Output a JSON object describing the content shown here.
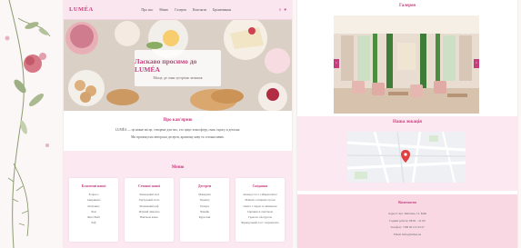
{
  "nav": {
    "brand": "LUMÉA",
    "links": [
      "Про нас",
      "Меню",
      "Галерея",
      "Контакти",
      "Бронювання"
    ],
    "icons": [
      "search-icon",
      "cart-icon"
    ]
  },
  "hero": {
    "title": "Ласкаво просимо до LUMÉA",
    "subtitle": "Місце, де смак зустрічає затишок"
  },
  "about": {
    "title": "Про кав'ярню",
    "text_1": "LUMÉA — це ніжне місце, створене для тих, хто цінує атмосферу, смак і красу в деталях.",
    "text_2": "Ми пропонуємо авторські десерти, ароматну каву та сезонні меню."
  },
  "menu": {
    "title": "Меню",
    "cards": [
      {
        "title": "Класичні напої",
        "items": [
          "Еспресо",
          "Американо",
          "Капучино",
          "Лате",
          "Флет Вайт",
          "Раф"
        ]
      },
      {
        "title": "Сезонні напої",
        "items": [
          "Лавандовий лате",
          "Гарбузовий латте",
          "Малиновий раф",
          "Ягідний лимонад",
          "Ванільна какао"
        ]
      },
      {
        "title": "Десерти",
        "items": [
          "Макаруни",
          "Тірамісу",
          "Еклери",
          "Чізкейк",
          "Круасани"
        ]
      },
      {
        "title": "Сніданки",
        "items": [
          "Авокадо тост з яйцем пашот",
          "Млинці з ягідним соусом",
          "Омлет з сиром та шпинатом",
          "Сирники зі сметаною",
          "Гранола з йогуртом",
          "Французький тост з карамеллю"
        ]
      }
    ]
  },
  "gallery": {
    "title": "Галерея",
    "prev": "‹",
    "next": "›"
  },
  "find": {
    "title": "Наша локація"
  },
  "contact": {
    "title": "Контакти",
    "lines": [
      "Адреса: вул. Квіткова, 12, Київ",
      "Години роботи: 08:00 – 21:00",
      "Телефон: +380 00 123 45 67",
      "Email: hello@lumea.ua"
    ]
  },
  "colors": {
    "accent": "#c63d7e",
    "nav_bg": "#f9e6ee",
    "section_bg": "#fce8f0",
    "contact_bg": "#f9d8e4"
  }
}
